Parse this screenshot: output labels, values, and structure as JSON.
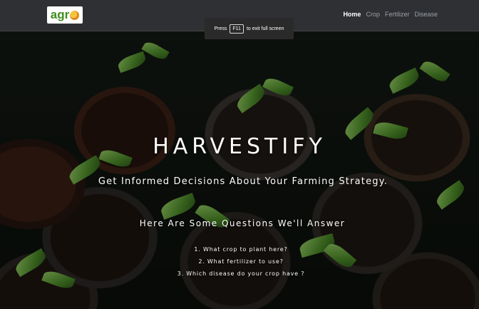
{
  "navbar": {
    "brand": {
      "text": "agr",
      "o_icon": "orange-sun-o-icon"
    },
    "links": [
      {
        "label": "Home",
        "active": true
      },
      {
        "label": "Crop",
        "active": false
      },
      {
        "label": "Fertilizer",
        "active": false
      },
      {
        "label": "Disease",
        "active": false
      }
    ]
  },
  "fullscreen_notice": {
    "prefix": "Press",
    "key": "F11",
    "suffix": "to exit full screen"
  },
  "hero": {
    "title": "HARVESTIFY",
    "subtitle": "Get Informed Decisions About Your Farming Strategy.",
    "questions_heading": "Here Are Some Questions We'll Answer",
    "questions": [
      "1. What crop to plant here?",
      "2. What fertilizer to use?",
      "3. Which disease do your crop have ?"
    ]
  },
  "colors": {
    "navbar_bg": "#2f3033",
    "brand_green": "#3e8e1e",
    "brand_orange": "#e08a1a",
    "active_link": "#ffffff",
    "inactive_link": "#9aa0a6"
  }
}
